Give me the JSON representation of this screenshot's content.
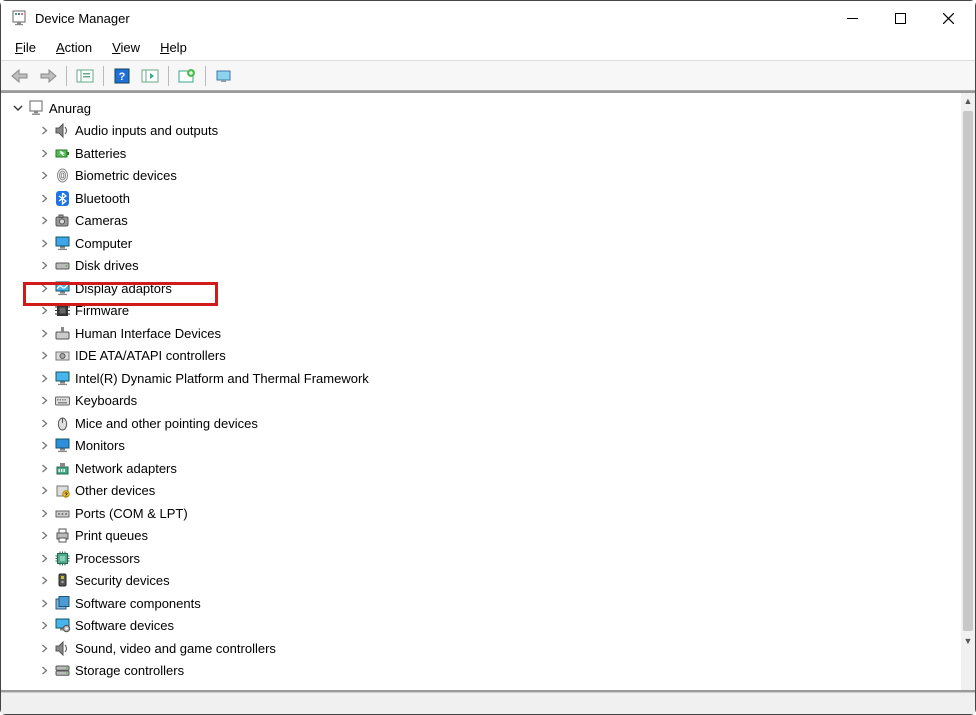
{
  "title": "Device Manager",
  "menus": {
    "file": "File",
    "action": "Action",
    "view": "View",
    "help": "Help"
  },
  "root": {
    "label": "Anurag"
  },
  "devices": [
    {
      "label": "Audio inputs and outputs",
      "icon": "speaker"
    },
    {
      "label": "Batteries",
      "icon": "battery"
    },
    {
      "label": "Biometric devices",
      "icon": "finger"
    },
    {
      "label": "Bluetooth",
      "icon": "bt"
    },
    {
      "label": "Cameras",
      "icon": "camera"
    },
    {
      "label": "Computer",
      "icon": "monitor"
    },
    {
      "label": "Disk drives",
      "icon": "drive"
    },
    {
      "label": "Display adaptors",
      "icon": "display",
      "highlighted": true
    },
    {
      "label": "Firmware",
      "icon": "chipdark"
    },
    {
      "label": "Human Interface Devices",
      "icon": "hid"
    },
    {
      "label": "IDE ATA/ATAPI controllers",
      "icon": "ide"
    },
    {
      "label": "Intel(R) Dynamic Platform and Thermal Framework",
      "icon": "monitor2"
    },
    {
      "label": "Keyboards",
      "icon": "keyboard"
    },
    {
      "label": "Mice and other pointing devices",
      "icon": "mouse"
    },
    {
      "label": "Monitors",
      "icon": "monitorblue"
    },
    {
      "label": "Network adapters",
      "icon": "net"
    },
    {
      "label": "Other devices",
      "icon": "other"
    },
    {
      "label": "Ports (COM & LPT)",
      "icon": "port"
    },
    {
      "label": "Print queues",
      "icon": "printer"
    },
    {
      "label": "Processors",
      "icon": "cpu"
    },
    {
      "label": "Security devices",
      "icon": "security"
    },
    {
      "label": "Software components",
      "icon": "swcomp"
    },
    {
      "label": "Software devices",
      "icon": "swdev"
    },
    {
      "label": "Sound, video and game controllers",
      "icon": "speaker"
    },
    {
      "label": "Storage controllers",
      "icon": "storage"
    }
  ]
}
